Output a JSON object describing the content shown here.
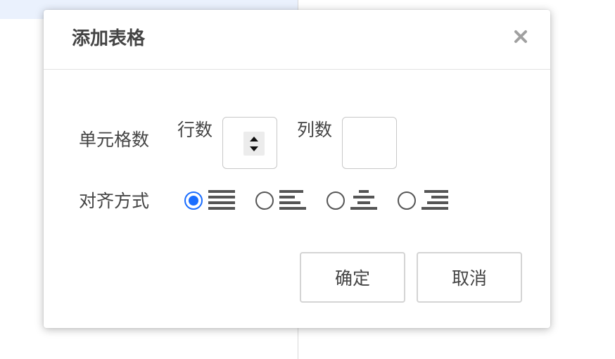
{
  "dialog": {
    "title": "添加表格",
    "close_icon": "close-icon"
  },
  "cells": {
    "label": "单元格数",
    "rows_label": "行数",
    "rows_value": "",
    "cols_label": "列数",
    "cols_value": ""
  },
  "alignment": {
    "label": "对齐方式",
    "options": [
      {
        "icon": "align-justify-icon",
        "checked": true
      },
      {
        "icon": "align-left-icon",
        "checked": false
      },
      {
        "icon": "align-center-icon",
        "checked": false
      },
      {
        "icon": "align-right-icon",
        "checked": false
      }
    ]
  },
  "buttons": {
    "confirm": "确定",
    "cancel": "取消"
  },
  "colors": {
    "accent": "#1a6dff",
    "icon_gray": "#555555",
    "border": "#d4d4d4"
  }
}
